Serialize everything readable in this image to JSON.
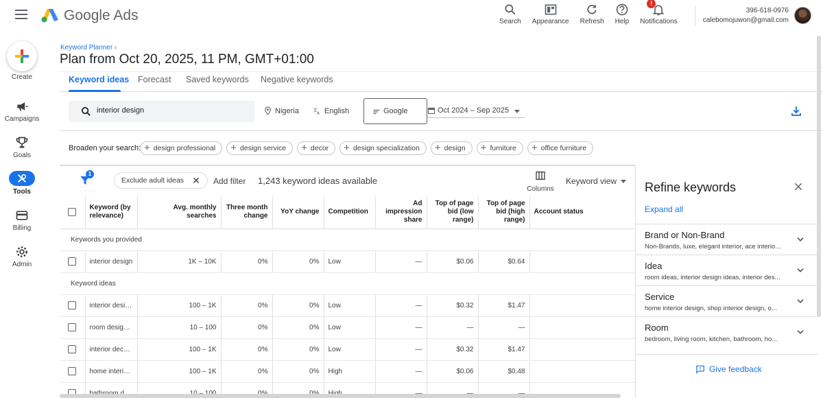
{
  "app": {
    "brand": "Google Ads"
  },
  "topbar": {
    "actions": [
      {
        "label": "Search",
        "icon": "search-icon"
      },
      {
        "label": "Appearance",
        "icon": "appearance-icon"
      },
      {
        "label": "Refresh",
        "icon": "refresh-icon"
      },
      {
        "label": "Help",
        "icon": "help-icon"
      },
      {
        "label": "Notifications",
        "icon": "bell-icon",
        "badge": "!"
      }
    ],
    "account_number": "396-618-0976",
    "account_email": "calebomojuwon@gmail.com"
  },
  "leftnav": {
    "create_label": "Create",
    "items": [
      {
        "label": "Campaigns",
        "icon": "megaphone-icon"
      },
      {
        "label": "Goals",
        "icon": "trophy-icon"
      },
      {
        "label": "Tools",
        "icon": "tools-icon",
        "active": true
      },
      {
        "label": "Billing",
        "icon": "credit-card-icon"
      },
      {
        "label": "Admin",
        "icon": "gear-icon"
      }
    ]
  },
  "header": {
    "breadcrumb": "Keyword Planner",
    "title": "Plan from Oct 20, 2025, 11 PM, GMT+01:00",
    "tabs": [
      "Keyword ideas",
      "Forecast",
      "Saved keywords",
      "Negative keywords"
    ]
  },
  "search": {
    "value": "interior design",
    "location": "Nigeria",
    "language": "English",
    "network": "Google",
    "date_range": "Oct 2024 – Sep 2025"
  },
  "broaden": {
    "label": "Broaden your search:",
    "chips": [
      "design professional",
      "design service",
      "decor",
      "design specialization",
      "design",
      "furniture",
      "office furniture"
    ]
  },
  "toolbar": {
    "filter_badge": "1",
    "exclude_chip": "Exclude adult ideas",
    "add_filter": "Add filter",
    "ideas_count": "1,243 keyword ideas available",
    "columns_label": "Columns",
    "view_label": "Keyword view"
  },
  "table": {
    "headers": [
      "Keyword (by relevance)",
      "Avg. monthly searches",
      "Three month change",
      "YoY change",
      "Competition",
      "Ad impression share",
      "Top of page bid (low range)",
      "Top of page bid (high range)",
      "Account status"
    ],
    "group_provided": "Keywords you provided",
    "provided_rows": [
      [
        "interior design",
        "1K – 10K",
        "0%",
        "0%",
        "Low",
        "—",
        "$0.06",
        "$0.64",
        ""
      ]
    ],
    "group_ideas": "Keyword ideas",
    "idea_rows": [
      [
        "interior design...",
        "100 – 1K",
        "0%",
        "0%",
        "Low",
        "—",
        "$0.32",
        "$1.47",
        ""
      ],
      [
        "room designer",
        "10 – 100",
        "0%",
        "0%",
        "Low",
        "—",
        "—",
        "—",
        ""
      ],
      [
        "interior decor...",
        "100 – 1K",
        "0%",
        "0%",
        "Low",
        "—",
        "$0.32",
        "$1.47",
        ""
      ],
      [
        "home interior...",
        "100 – 1K",
        "0%",
        "0%",
        "High",
        "—",
        "$0.06",
        "$0.48",
        ""
      ],
      [
        "bathroom de...",
        "10 – 100",
        "0%",
        "0%",
        "High",
        "—",
        "—",
        "—",
        ""
      ]
    ]
  },
  "refine": {
    "title": "Refine keywords",
    "expand_all": "Expand all",
    "items": [
      {
        "name": "Brand or Non-Brand",
        "desc": "Non-Brands, luxe, elegant interior, ace interior..."
      },
      {
        "name": "Idea",
        "desc": "room ideas, interior design ideas, interior des..."
      },
      {
        "name": "Service",
        "desc": "home interior design, shop interior design, o..."
      },
      {
        "name": "Room",
        "desc": "bedroom, living room, kitchen, bathroom, ho..."
      }
    ],
    "feedback": "Give feedback"
  },
  "colors": {
    "accent": "#1a73e8",
    "badge_red": "#d93025"
  }
}
